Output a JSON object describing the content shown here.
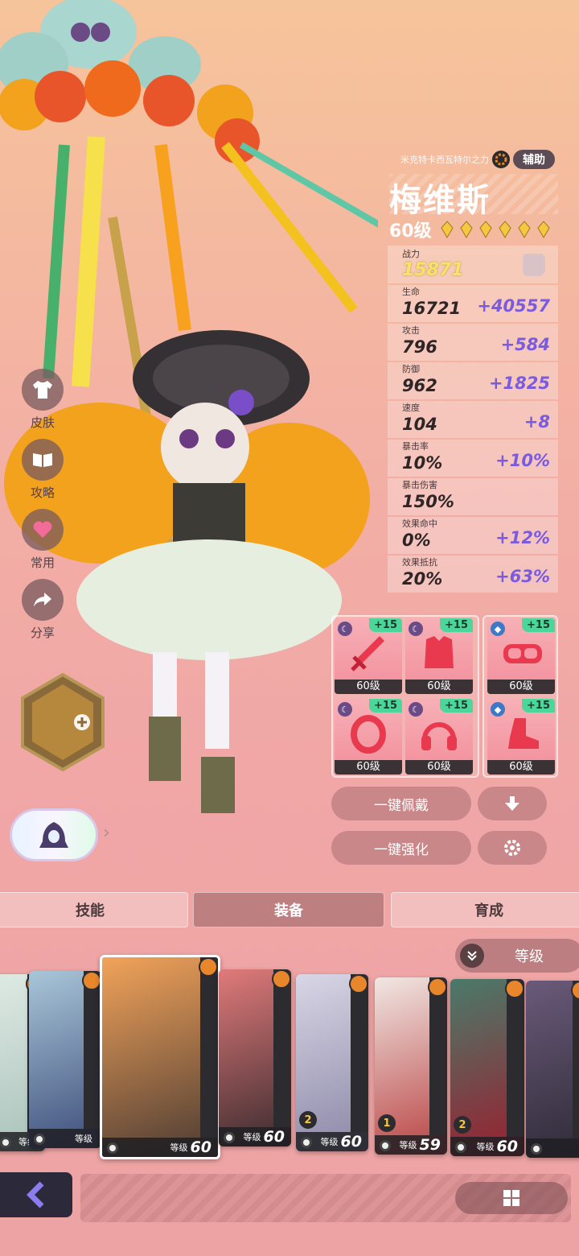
{
  "hero": {
    "origin": "米克特卡西瓦特尔之力",
    "class": "辅助",
    "name": "梅维斯",
    "level": "60级",
    "stars": 6
  },
  "side_menu": [
    {
      "label": "皮肤",
      "icon": "shirt-icon"
    },
    {
      "label": "攻略",
      "icon": "book-icon"
    },
    {
      "label": "常用",
      "icon": "heart-icon"
    },
    {
      "label": "分享",
      "icon": "share-icon"
    }
  ],
  "power": {
    "label": "战力",
    "value": "15871"
  },
  "stats": [
    {
      "label": "生命",
      "value": "16721",
      "bonus": "+40557"
    },
    {
      "label": "攻击",
      "value": "796",
      "bonus": "+584"
    },
    {
      "label": "防御",
      "value": "962",
      "bonus": "+1825"
    },
    {
      "label": "速度",
      "value": "104",
      "bonus": "+8"
    },
    {
      "label": "暴击率",
      "value": "10%",
      "bonus": "+10%"
    },
    {
      "label": "暴击伤害",
      "value": "150%",
      "bonus": ""
    },
    {
      "label": "效果命中",
      "value": "0%",
      "bonus": "+12%"
    },
    {
      "label": "效果抵抗",
      "value": "20%",
      "bonus": "+63%"
    }
  ],
  "equipment": [
    {
      "slot": "weapon",
      "icon": "sword-icon",
      "plus": "+15",
      "level": "60级"
    },
    {
      "slot": "armor",
      "icon": "armor-icon",
      "plus": "+15",
      "level": "60级"
    },
    {
      "slot": "goggles",
      "icon": "goggles-icon",
      "plus": "+15",
      "level": "60级"
    },
    {
      "slot": "ring",
      "icon": "ring-icon",
      "plus": "+15",
      "level": "60级"
    },
    {
      "slot": "headphones",
      "icon": "headphones-icon",
      "plus": "+15",
      "level": "60级"
    },
    {
      "slot": "boots",
      "icon": "boots-icon",
      "plus": "+15",
      "level": "60级"
    }
  ],
  "actions": {
    "equip_all": "一键佩戴",
    "enhance_all": "一键强化"
  },
  "tabs": [
    {
      "label": "技能",
      "active": false
    },
    {
      "label": "装备",
      "active": true
    },
    {
      "label": "育成",
      "active": false
    }
  ],
  "sort": {
    "label": "等级"
  },
  "roster": [
    {
      "level_label": "等级",
      "level": "",
      "awake": ""
    },
    {
      "level_label": "等级",
      "level": "",
      "awake": ""
    },
    {
      "level_label": "等级",
      "level": "60",
      "awake": "",
      "selected": true
    },
    {
      "level_label": "等级",
      "level": "60",
      "awake": ""
    },
    {
      "level_label": "等级",
      "level": "60",
      "awake": "2"
    },
    {
      "level_label": "等级",
      "level": "59",
      "awake": "1"
    },
    {
      "level_label": "等级",
      "level": "60",
      "awake": "2"
    },
    {
      "level_label": "",
      "level": "",
      "awake": ""
    }
  ],
  "colors": {
    "bonus": "#7a5be0",
    "power": "#f5e36a",
    "equip_plus": "#4bd69c",
    "accent_dark": "#2c2a3a"
  }
}
